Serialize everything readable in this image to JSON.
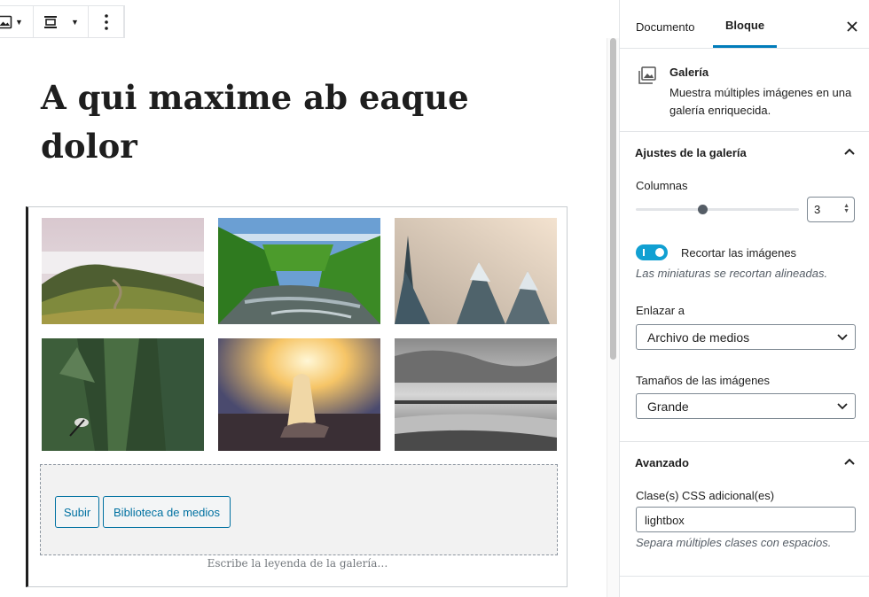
{
  "toolbar": {
    "icons": [
      "image-icon",
      "align-center-icon",
      "more-vertical-icon"
    ]
  },
  "editor": {
    "post_title": "A qui maxime ab eaque dolor",
    "gallery": {
      "images": [
        "hills-and-fog",
        "river-forest",
        "snowy-trees",
        "forest-biker",
        "woman-sunset",
        "bw-beach"
      ],
      "upload_label": "Subir",
      "library_label": "Biblioteca de medios",
      "caption_placeholder": "Escribe la leyenda de la galería…"
    }
  },
  "sidebar": {
    "tabs": [
      "Documento",
      "Bloque"
    ],
    "active_tab": "Bloque",
    "block": {
      "name": "Galería",
      "description": "Muestra múltiples imágenes en una galería enriquecida."
    },
    "gallery_settings": {
      "title": "Ajustes de la galería",
      "columns_label": "Columnas",
      "columns_value": "3",
      "columns_level": 0.375,
      "crop_label": "Recortar las imágenes",
      "crop_on": true,
      "crop_help": "Las miniaturas se recortan alineadas.",
      "link_label": "Enlazar a",
      "link_value": "Archivo de medios",
      "size_label": "Tamaños de las imágenes",
      "size_value": "Grande"
    },
    "advanced": {
      "title": "Avanzado",
      "css_label": "Clase(s) CSS adicional(es)",
      "css_value": "lightbox",
      "css_help": "Separa múltiples clases con espacios."
    }
  },
  "colors": {
    "accent": "#007cba",
    "toggle": "#11a0d2",
    "button_text": "#0071a1"
  }
}
